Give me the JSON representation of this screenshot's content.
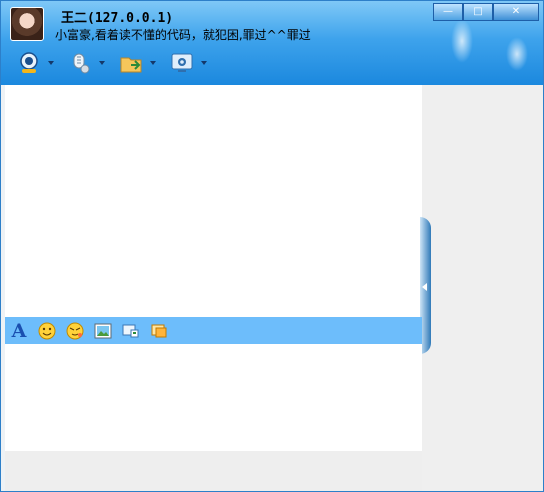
{
  "window": {
    "name": "王二",
    "ip": "(127.0.0.1)",
    "signature": "小富豪,看着读不懂的代码，就犯困,罪过^^罪过",
    "controls": {
      "minimize": "—",
      "maximize": "□",
      "close": "✕"
    }
  },
  "toolbar": {
    "items": [
      {
        "icon": "video-call-icon"
      },
      {
        "icon": "voice-call-icon"
      },
      {
        "icon": "send-file-icon"
      },
      {
        "icon": "remote-assist-icon"
      }
    ]
  },
  "format_bar": {
    "font_label": "A",
    "items": [
      {
        "icon": "font-icon"
      },
      {
        "icon": "emoticon-icon"
      },
      {
        "icon": "magic-emoticon-icon"
      },
      {
        "icon": "image-icon"
      },
      {
        "icon": "screenshot-icon"
      },
      {
        "icon": "shake-icon"
      }
    ]
  },
  "colors": {
    "header_top": "#7fc8f7",
    "header_bottom": "#1b88de",
    "format_bar": "#6dbdfb",
    "sidebar": "#efefef"
  }
}
